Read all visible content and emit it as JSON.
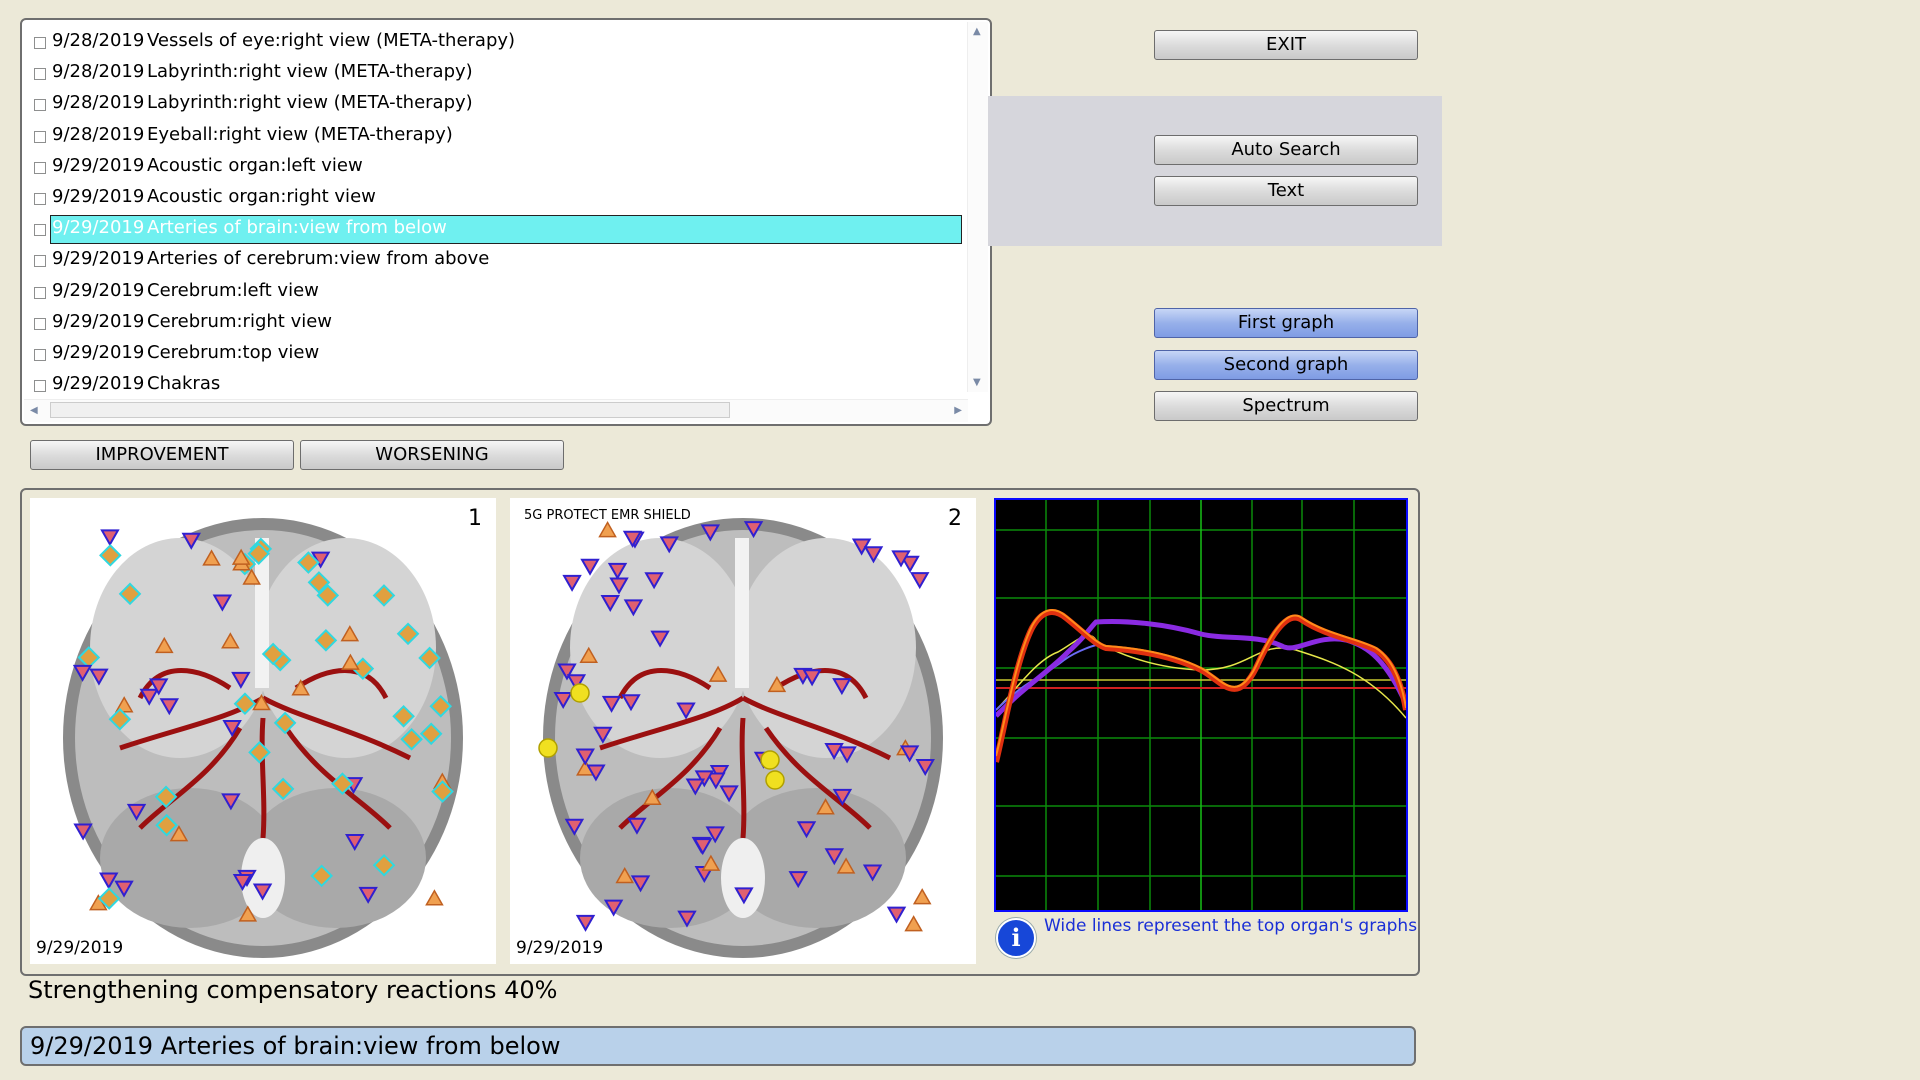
{
  "sessions": [
    {
      "date": "9/28/2019",
      "title": "Vessels of eye:right view  (META-therapy)"
    },
    {
      "date": "9/28/2019",
      "title": "Labyrinth:right view  (META-therapy)"
    },
    {
      "date": "9/28/2019",
      "title": "Labyrinth:right view  (META-therapy)"
    },
    {
      "date": "9/28/2019",
      "title": "Eyeball:right view  (META-therapy)"
    },
    {
      "date": "9/29/2019",
      "title": "Acoustic organ:left view"
    },
    {
      "date": "9/29/2019",
      "title": "Acoustic organ:right view"
    },
    {
      "date": "9/29/2019",
      "title": "Arteries of brain:view from below",
      "selected": true
    },
    {
      "date": "9/29/2019",
      "title": "Arteries of cerebrum:view from above"
    },
    {
      "date": "9/29/2019",
      "title": "Cerebrum:left view"
    },
    {
      "date": "9/29/2019",
      "title": "Cerebrum:right view"
    },
    {
      "date": "9/29/2019",
      "title": "Cerebrum:top view"
    },
    {
      "date": "9/29/2019",
      "title": "Chakras"
    }
  ],
  "buttons": {
    "exit": "EXIT",
    "auto_search": "Auto Search",
    "text": "Text",
    "first_graph": "First graph",
    "second_graph": "Second graph",
    "spectrum": "Spectrum",
    "improvement": "IMPROVEMENT",
    "worsening": "WORSENING"
  },
  "images": {
    "left": {
      "number": "1",
      "date": "9/29/2019"
    },
    "right": {
      "number": "2",
      "date": "9/29/2019",
      "caption": "5G PROTECT EMR SHIELD"
    }
  },
  "info_text": "Wide lines represent the top organ's graphs",
  "status_text": "Strengthening compensatory reactions 40%",
  "title_bar": "9/29/2019 Arteries of brain:view from below",
  "colors": {
    "selected_row": "#6ff0f0",
    "blue_button": "#97b0ea",
    "title_bar": "#b9d1ea",
    "info_icon": "#1747d8"
  }
}
